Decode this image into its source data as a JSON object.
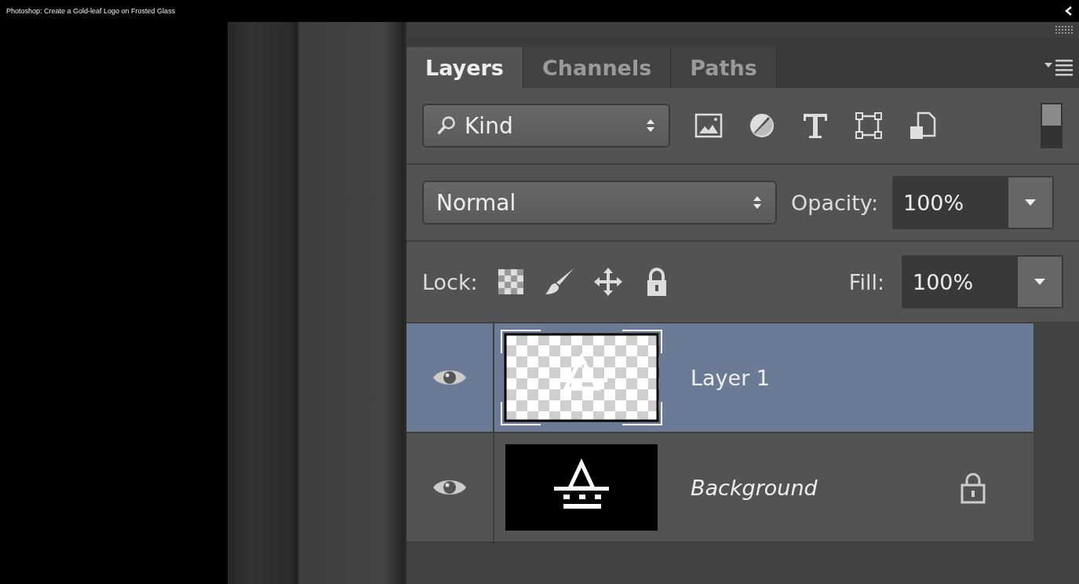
{
  "video_title": "Photoshop: Create a Gold-leaf Logo on Frosted Glass",
  "tabs": [
    {
      "label": "Layers",
      "selected": true
    },
    {
      "label": "Channels",
      "selected": false
    },
    {
      "label": "Paths",
      "selected": false
    }
  ],
  "filter": {
    "value": "Kind",
    "filter_on": true
  },
  "blend_mode": {
    "value": "Normal"
  },
  "opacity": {
    "label": "Opacity:",
    "value": "100%"
  },
  "lock": {
    "label": "Lock:"
  },
  "fill": {
    "label": "Fill:",
    "value": "100%"
  },
  "layers": [
    {
      "name": "Layer 1",
      "kind": "transparent",
      "visible": true,
      "selected": true,
      "locked": false
    },
    {
      "name": "Background",
      "kind": "background",
      "visible": true,
      "selected": false,
      "locked": true
    }
  ]
}
